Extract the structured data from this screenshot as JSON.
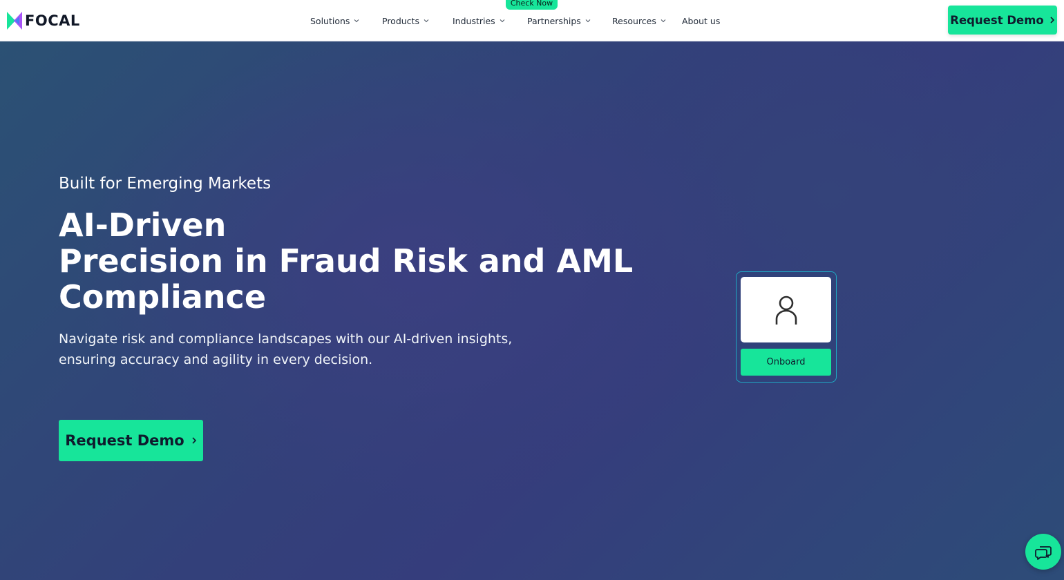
{
  "brand": {
    "name": "FOCAL",
    "accent_color": "#17e59a",
    "logo_colors": [
      "#17e59a",
      "#3b82f6",
      "#a855f7"
    ]
  },
  "header": {
    "nav": [
      {
        "label": "Solutions",
        "has_dropdown": true
      },
      {
        "label": "Products",
        "has_dropdown": true
      },
      {
        "label": "Industries",
        "has_dropdown": true
      },
      {
        "label": "Partnerships",
        "has_dropdown": true
      },
      {
        "label": "Resources",
        "has_dropdown": true
      },
      {
        "label": "About us",
        "has_dropdown": false
      }
    ],
    "check_now_label": "Check Now",
    "cta_label": "Request Demo"
  },
  "hero": {
    "eyebrow": "Built for Emerging Markets",
    "headline_lines": [
      "AI-Driven",
      "Precision in Fraud Risk and AML",
      "Compliance"
    ],
    "subtext_lines": [
      "Navigate risk and compliance landscapes with our AI-driven insights,",
      "ensuring accuracy and agility in every decision."
    ],
    "cta_label": "Request Demo"
  },
  "onboard_card": {
    "button_label": "Onboard",
    "icon": "user-icon"
  },
  "chat": {
    "icon": "chat-icon"
  }
}
